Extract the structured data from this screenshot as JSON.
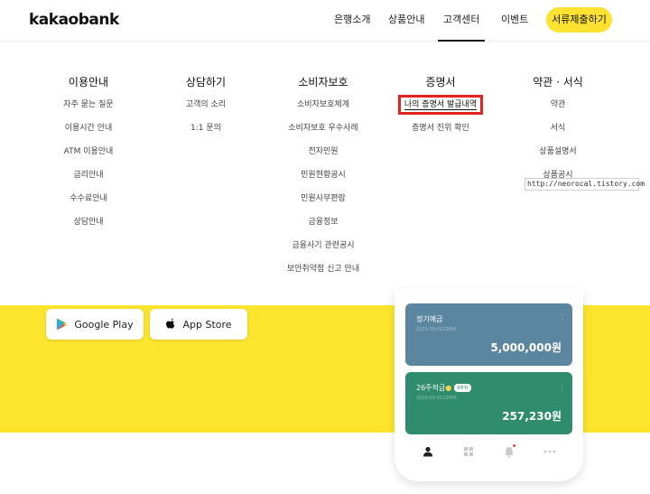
{
  "header": {
    "logo": "kakaobank",
    "nav": [
      {
        "label": "은행소개"
      },
      {
        "label": "상품안내"
      },
      {
        "label": "고객센터"
      },
      {
        "label": "이벤트"
      }
    ],
    "cta_label": "서류제출하기"
  },
  "menu": {
    "columns": [
      {
        "title": "이용안내",
        "items": [
          "자주 묻는 질문",
          "이용시간 안내",
          "ATM 이용안내",
          "금리안내",
          "수수료안내",
          "상담안내"
        ]
      },
      {
        "title": "상담하기",
        "items": [
          "고객의 소리",
          "1:1 문의"
        ]
      },
      {
        "title": "소비자보호",
        "items": [
          "소비자보호체계",
          "소비자보호 우수사례",
          "전자민원",
          "민원현황공시",
          "민원사무편람",
          "금융정보",
          "금융사기 관련공시",
          "보안취약점 신고 안내"
        ]
      },
      {
        "title": "증명서",
        "items": [
          "나의 증명서 발급내역",
          "증명서 진위 확인"
        ]
      },
      {
        "title": "약관 · 서식",
        "items": [
          "약관",
          "서식",
          "상품설명서",
          "상품공시"
        ]
      }
    ]
  },
  "watermark": "http://neorocal.tistory.com",
  "store": {
    "google_play": "Google Play",
    "app_store": "App Store"
  },
  "phone": {
    "cards": [
      {
        "name": "정기예금",
        "account": "3333-09-0123456",
        "amount": "5,000,000원",
        "color": "#5b86a0"
      },
      {
        "name": "26주적금",
        "badge": "8주차",
        "account": "3333-09-0123456",
        "amount": "257,230원",
        "color": "#2f8c6c"
      }
    ]
  },
  "colors": {
    "brand_yellow": "#fde231",
    "highlight_red": "#e3231f"
  }
}
